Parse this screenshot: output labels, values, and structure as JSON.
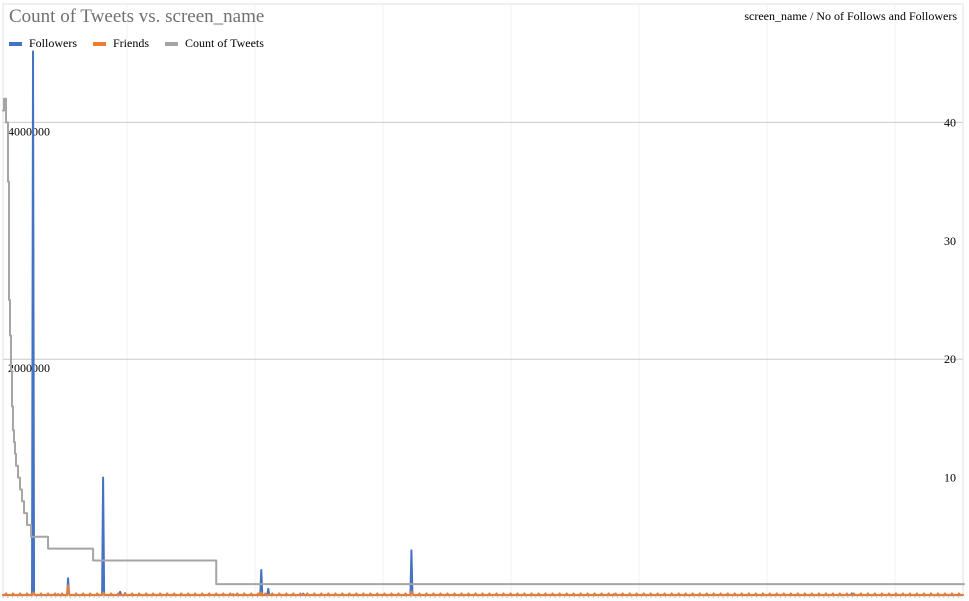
{
  "chart_data": {
    "type": "line",
    "title": "Count of Tweets vs. screen_name",
    "subtitle": "screen_name / No of Follows and Followers",
    "xlabel": "",
    "ylabel_left": "",
    "ylabel_right": "",
    "x_count": 960,
    "left_axis": {
      "ticks": [
        2000000,
        4000000
      ],
      "ylim": [
        0,
        5000000
      ]
    },
    "right_axis": {
      "ticks": [
        10,
        20,
        30,
        40
      ],
      "ylim": [
        0,
        50
      ]
    },
    "legend_position": "top-left",
    "grid": true,
    "series": [
      {
        "name": "Followers",
        "color": "#4472C4",
        "axis": "left",
        "baseline": 8000,
        "spikes": [
          [
            3,
            10000
          ],
          [
            30,
            4600000
          ],
          [
            55,
            15000
          ],
          [
            65,
            150000
          ],
          [
            100,
            1000000
          ],
          [
            117,
            35000
          ],
          [
            122,
            25000
          ],
          [
            230,
            15000
          ],
          [
            258,
            220000
          ],
          [
            265,
            60000
          ],
          [
            300,
            20000
          ],
          [
            408,
            385000
          ],
          [
            500,
            12000
          ],
          [
            610,
            15000
          ],
          [
            640,
            20000
          ],
          [
            848,
            22000
          ]
        ]
      },
      {
        "name": "Friends",
        "color": "#ED7D31",
        "axis": "right",
        "baseline": 0.1,
        "spikes": [
          [
            30,
            0.3
          ],
          [
            65,
            0.9
          ],
          [
            100,
            0.3
          ],
          [
            258,
            0.3
          ],
          [
            408,
            0.4
          ]
        ]
      },
      {
        "name": "Count of Tweets",
        "color": "#A5A5A5",
        "axis": "right",
        "steps": [
          [
            0,
            41
          ],
          [
            1,
            42
          ],
          [
            2,
            42
          ],
          [
            3,
            40
          ],
          [
            5,
            35
          ],
          [
            6,
            25
          ],
          [
            7,
            22
          ],
          [
            8,
            19
          ],
          [
            9,
            16
          ],
          [
            10,
            14
          ],
          [
            11,
            13
          ],
          [
            12,
            12
          ],
          [
            13,
            11
          ],
          [
            15,
            10
          ],
          [
            17,
            9
          ],
          [
            19,
            8
          ],
          [
            21,
            7
          ],
          [
            24,
            6
          ],
          [
            28,
            5
          ],
          [
            45,
            4
          ],
          [
            90,
            3
          ],
          [
            213,
            1
          ]
        ],
        "last_x": 960
      }
    ]
  }
}
